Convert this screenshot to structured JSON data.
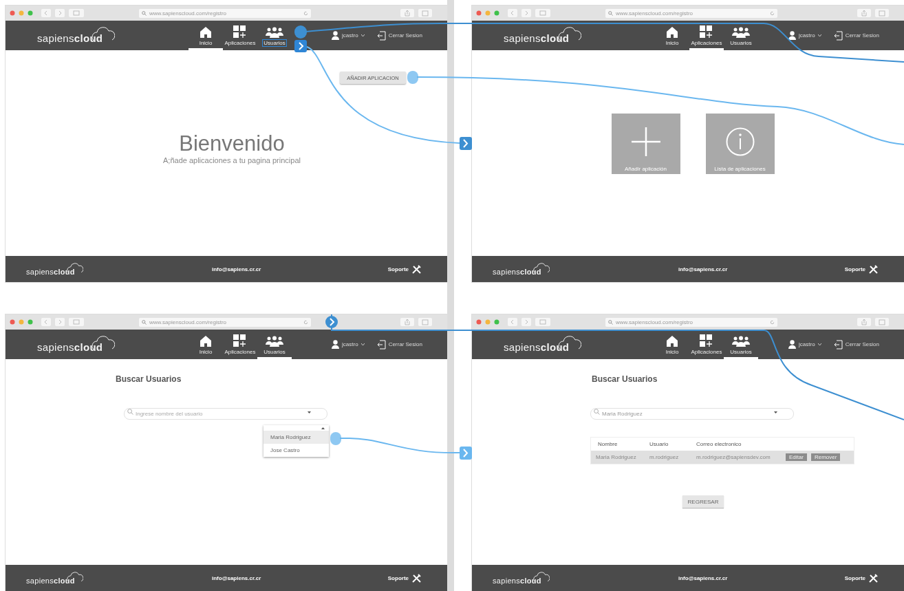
{
  "screens": [
    {
      "url": "www.sapienscloud.com/registro",
      "nav": {
        "logo": "sapiens**cloud**",
        "items": [
          {
            "kind": "home",
            "label": "Inicio",
            "selected": true,
            "hotspot": false
          },
          {
            "kind": "apps",
            "label": "Aplicaciones",
            "selected": false,
            "hotspot": false
          },
          {
            "kind": "users",
            "label": "Usuarios",
            "selected": false,
            "hotspot": true
          }
        ],
        "user": "jcastro",
        "logout": "Cerrar Sesion"
      },
      "content": {
        "kind": "welcome",
        "title": "Bienvenido",
        "subtitle": "A;ñade aplicaciones a tu pagina principal",
        "action": "AÑADIR APLICACION"
      },
      "footer": {
        "logo": "sapiens**cloud**",
        "email": "info@sapiens.cr.cr",
        "support": "Soporte"
      }
    },
    {
      "url": "www.sapienscloud.com/registro",
      "nav": {
        "logo": "sapiens**cloud**",
        "items": [
          {
            "kind": "home",
            "label": "Inicio",
            "selected": false,
            "hotspot": false
          },
          {
            "kind": "apps",
            "label": "Aplicaciones",
            "selected": true,
            "hotspot": false
          },
          {
            "kind": "users",
            "label": "Usuarios",
            "selected": false,
            "hotspot": false
          }
        ],
        "user": "jcastro",
        "logout": "Cerrar Sesion"
      },
      "content": {
        "kind": "tiles",
        "tiles": [
          {
            "kind": "add",
            "label": "Añadir aplicación"
          },
          {
            "kind": "info",
            "label": "Lista de aplicaciones"
          }
        ]
      },
      "footer": {
        "logo": "sapiens**cloud**",
        "email": "info@sapiens.cr.cr",
        "support": "Soporte"
      }
    },
    {
      "url": "www.sapienscloud.com/registro",
      "nav": {
        "logo": "sapiens**cloud**",
        "items": [
          {
            "kind": "home",
            "label": "Inicio",
            "selected": false,
            "hotspot": false
          },
          {
            "kind": "apps",
            "label": "Aplicaciones",
            "selected": false,
            "hotspot": false
          },
          {
            "kind": "users",
            "label": "Usuarios",
            "selected": true,
            "hotspot": false
          }
        ],
        "user": "jcastro",
        "logout": "Cerrar Sesion"
      },
      "content": {
        "kind": "search",
        "heading": "Buscar Usuarios",
        "search": {
          "placeholder": "Ingrese nombre del usuario"
        },
        "options": [
          {
            "label": "Maria Rodriguez",
            "selected": true
          },
          {
            "label": "Jose Castro",
            "selected": false
          }
        ]
      },
      "footer": {
        "logo": "sapiens**cloud**",
        "email": "info@sapiens.cr.cr",
        "support": "Soporte"
      }
    },
    {
      "url": "www.sapienscloud.com/registro",
      "nav": {
        "logo": "sapiens**cloud**",
        "items": [
          {
            "kind": "home",
            "label": "Inicio",
            "selected": false,
            "hotspot": false
          },
          {
            "kind": "apps",
            "label": "Aplicaciones",
            "selected": false,
            "hotspot": false
          },
          {
            "kind": "users",
            "label": "Usuarios",
            "selected": true,
            "hotspot": false
          }
        ],
        "user": "jcastro",
        "logout": "Cerrar Sesion"
      },
      "content": {
        "kind": "results",
        "heading": "Buscar Usuarios",
        "search": {
          "value": "Maria Rodriguez"
        },
        "columns": [
          "Nombre",
          "Usuario",
          "Correo electronico"
        ],
        "rows": [
          {
            "cells": [
              "Maria Rodriguez",
              "m.rodriguez",
              "m.rodriguez@sapiensdev.com"
            ],
            "actions": [
              "Editar",
              "Remover"
            ]
          }
        ],
        "back": "REGRESAR"
      },
      "footer": {
        "logo": "sapiens**cloud**",
        "email": "info@sapiens.cr.cr",
        "support": "Soporte"
      }
    }
  ]
}
